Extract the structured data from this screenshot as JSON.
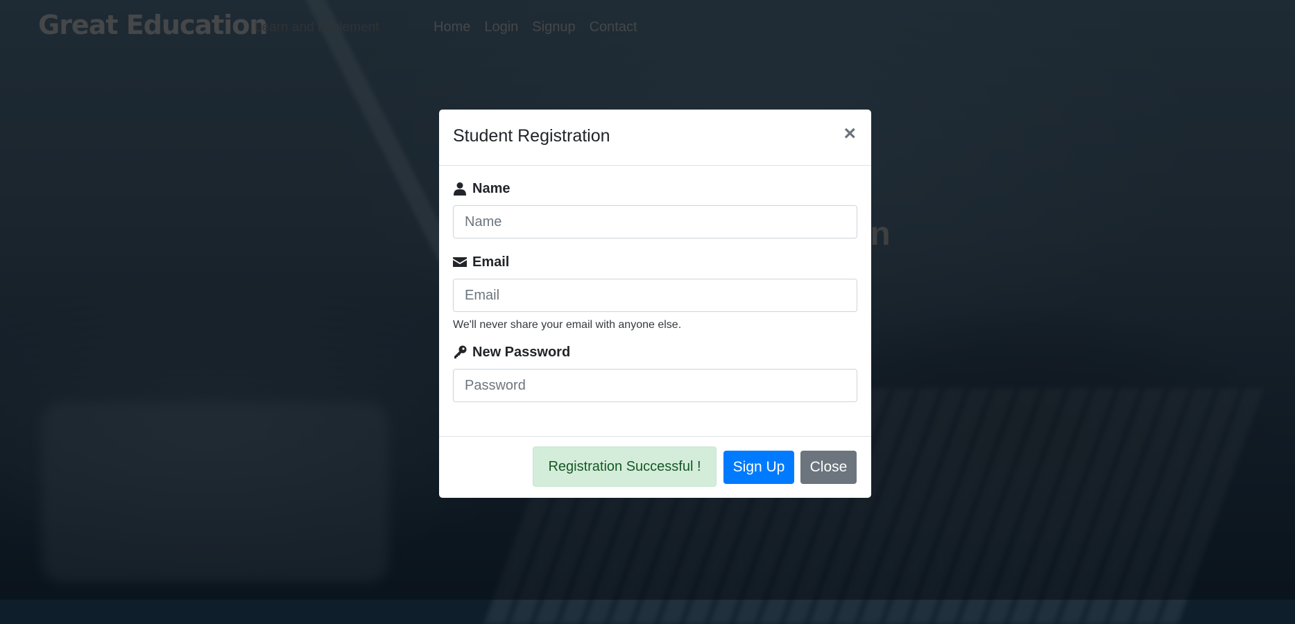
{
  "navbar": {
    "brand": "Great Education",
    "tagline": "Learn and Implement",
    "links": [
      "Home",
      "Login",
      "Signup",
      "Contact"
    ]
  },
  "hero": {
    "title_fragment": "on"
  },
  "modal": {
    "title": "Student Registration",
    "close_symbol": "×",
    "fields": {
      "name": {
        "label": "Name",
        "placeholder": "Name",
        "icon": "user-icon"
      },
      "email": {
        "label": "Email",
        "placeholder": "Email",
        "icon": "envelope-icon",
        "help": "We'll never share your email with anyone else."
      },
      "password": {
        "label": "New Password",
        "placeholder": "Password",
        "icon": "key-icon"
      }
    },
    "footer": {
      "alert": "Registration Successful !",
      "signup_label": "Sign Up",
      "close_label": "Close"
    }
  },
  "colors": {
    "primary": "#007bff",
    "secondary": "#6c757d",
    "success_bg": "#d4edda",
    "success_text": "#155724"
  }
}
